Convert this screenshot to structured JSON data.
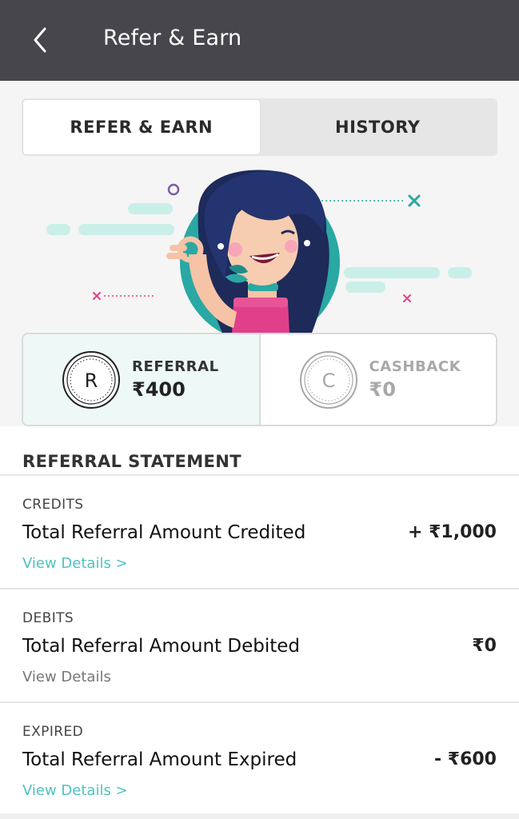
{
  "appbar": {
    "title": "Refer & Earn",
    "back_icon": "back-chevron-icon"
  },
  "tabs": [
    {
      "label": "REFER & EARN",
      "active": true
    },
    {
      "label": "HISTORY",
      "active": false
    }
  ],
  "wallets": [
    {
      "coin_letter": "R",
      "label": "REFERRAL",
      "amount": "₹400",
      "active": true
    },
    {
      "coin_letter": "C",
      "label": "CASHBACK",
      "amount": "₹0",
      "active": false
    }
  ],
  "statement": {
    "title": "REFERRAL STATEMENT",
    "items": [
      {
        "category": "CREDITS",
        "title": "Total Referral Amount Credited",
        "amount": "+ ₹1,000",
        "link": "View Details >",
        "link_active": true
      },
      {
        "category": "DEBITS",
        "title": "Total Referral Amount Debited",
        "amount": "₹0",
        "link": "View Details",
        "link_active": false
      },
      {
        "category": "EXPIRED",
        "title": "Total Referral Amount Expired",
        "amount": "- ₹600",
        "link": "View Details >",
        "link_active": true
      }
    ]
  },
  "colors": {
    "appbar": "#46464b",
    "accent": "#4fc3c0",
    "teal_circle": "#2aa8a3",
    "pink": "#e0408a"
  }
}
